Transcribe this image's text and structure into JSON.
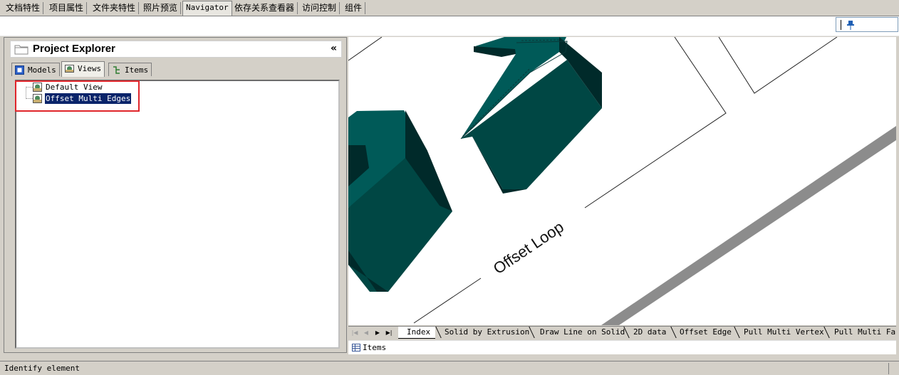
{
  "top_tabs": [
    {
      "label": "文档特性"
    },
    {
      "label": "项目属性"
    },
    {
      "label": "文件夹特性"
    },
    {
      "label": "照片预览"
    },
    {
      "label": "Navigator"
    },
    {
      "label": "依存关系查看器"
    },
    {
      "label": "访问控制"
    },
    {
      "label": "组件"
    }
  ],
  "explorer": {
    "title": "Project Explorer",
    "collapse_glyph": "«",
    "tabs": [
      {
        "label": "Models",
        "icon": "models-icon"
      },
      {
        "label": "Views",
        "icon": "views-icon"
      },
      {
        "label": "Items",
        "icon": "items-icon"
      }
    ],
    "active_tab": "Views",
    "tree": [
      {
        "label": "Default View",
        "icon": "view-icon",
        "selected": false
      },
      {
        "label": "Offset Multi Edges",
        "icon": "view-icon",
        "selected": true
      }
    ]
  },
  "viewport": {
    "annotation": "Offset Loop",
    "colors": {
      "solid_top": "#005a58",
      "solid_side": "#004744",
      "solid_dark": "#002a2a",
      "road": "#8c8c8c"
    }
  },
  "sheet_tabs": [
    {
      "label": "Index"
    },
    {
      "label": "Solid by Extrusion"
    },
    {
      "label": "Draw Line on Solid"
    },
    {
      "label": "2D data"
    },
    {
      "label": "Offset Edge"
    },
    {
      "label": "Pull Multi Vertex"
    },
    {
      "label": "Pull Multi Fac"
    }
  ],
  "active_sheet": "Index",
  "items_bar": {
    "label": "Items"
  },
  "status": {
    "text": "Identify element"
  },
  "colors": {
    "selection": "#0a246a",
    "highlight_box": "#e0252b",
    "chrome": "#d4d0c8"
  }
}
